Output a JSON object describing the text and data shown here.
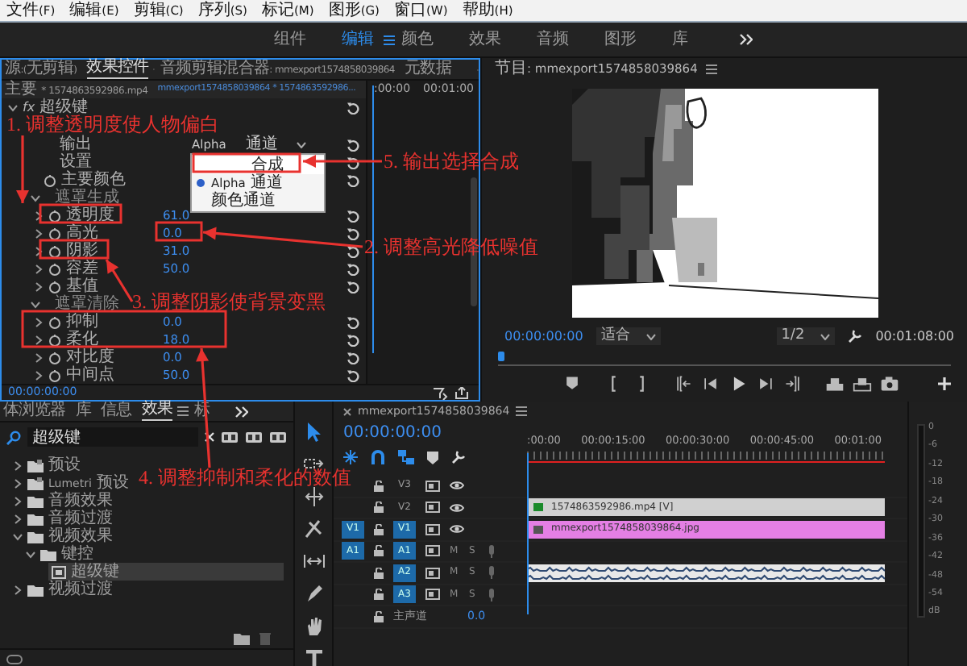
{
  "menu": [
    "文件(F)",
    "编辑(E)",
    "剪辑(C)",
    "序列(S)",
    "标记(M)",
    "图形(G)",
    "窗口(W)",
    "帮助(H)"
  ],
  "workspaces": [
    {
      "label": "组件",
      "selected": false
    },
    {
      "label": "编辑",
      "selected": true
    },
    {
      "label": "颜色",
      "selected": false
    },
    {
      "label": "效果",
      "selected": false
    },
    {
      "label": "音频",
      "selected": false
    },
    {
      "label": "图形",
      "selected": false
    },
    {
      "label": "库",
      "selected": false
    }
  ],
  "effect_controls": {
    "tabs": [
      {
        "label": "源:(无剪辑)",
        "selected": false
      },
      {
        "label": "效果控件",
        "selected": true
      },
      {
        "label": "音频剪辑混合器: mmexport1574858039864",
        "selected": false
      },
      {
        "label": "元数据",
        "selected": false
      }
    ],
    "master_clip": "主要 * 1574863592986.mp4",
    "sequence_clip": "mmexport1574858039864 * 1574863592986...",
    "ruler": [
      ":00:00",
      "00:01:00"
    ],
    "rows": [
      {
        "kind": "effect",
        "badge": "fx",
        "label": "超级键",
        "expanded": true
      },
      {
        "kind": "dropdown",
        "label": "输出",
        "value": "Alpha 通道"
      },
      {
        "kind": "setting",
        "label": "设置"
      },
      {
        "kind": "color",
        "label": "主要颜色"
      },
      {
        "kind": "group",
        "label": "遮罩生成",
        "expanded": true
      },
      {
        "kind": "property",
        "label": "透明度",
        "value": "61.0",
        "expanded": false
      },
      {
        "kind": "property",
        "label": "高光",
        "value": "0.0",
        "expanded": false
      },
      {
        "kind": "property",
        "label": "阴影",
        "value": "31.0",
        "expanded": false
      },
      {
        "kind": "property",
        "label": "容差",
        "value": "50.0",
        "expanded": false
      },
      {
        "kind": "property",
        "label": "基值",
        "expanded": false
      },
      {
        "kind": "group",
        "label": "遮罩清除",
        "expanded": true
      },
      {
        "kind": "property",
        "label": "抑制",
        "value": "0.0",
        "expanded": false
      },
      {
        "kind": "property",
        "label": "柔化",
        "value": "18.0",
        "expanded": false
      },
      {
        "kind": "property",
        "label": "对比度",
        "value": "0.0",
        "expanded": false
      },
      {
        "kind": "property",
        "label": "中间点",
        "value": "50.0",
        "expanded": false
      }
    ],
    "timecode": "00:00:00:00"
  },
  "output_menu": [
    {
      "label": "合成",
      "selected": true,
      "checked": false
    },
    {
      "label": "Alpha 通道",
      "selected": false,
      "checked": true
    },
    {
      "label": "颜色通道",
      "selected": false,
      "checked": false
    }
  ],
  "annotations": [
    "1. 调整透明度使人物偏白",
    "5. 输出选择合成",
    "2. 调整高光降低噪值",
    "3. 调整阴影使背景变黑",
    "4. 调整抑制和柔化的数值"
  ],
  "program": {
    "title": "节目: mmexport1574858039864",
    "timecode": "00:00:00:00",
    "zoom": "适合",
    "resolution": "1/2",
    "duration": "00:01:08:00"
  },
  "effects_panel": {
    "tabs": [
      {
        "label": "体浏览器",
        "selected": false
      },
      {
        "label": "库",
        "selected": false
      },
      {
        "label": "信息",
        "selected": false
      },
      {
        "label": "效果",
        "selected": true
      },
      {
        "label": "标",
        "selected": false
      }
    ],
    "search": {
      "value": "超级键"
    },
    "tree": [
      {
        "label": "预设",
        "kind": "preset",
        "expanded": false,
        "selected": false
      },
      {
        "label": "Lumetri 预设",
        "kind": "preset",
        "expanded": false,
        "selected": false
      },
      {
        "label": "音频效果",
        "kind": "folder",
        "expanded": false,
        "selected": false
      },
      {
        "label": "音频过渡",
        "kind": "folder",
        "expanded": false,
        "selected": false
      },
      {
        "label": "视频效果",
        "kind": "folder",
        "expanded": true,
        "selected": false,
        "children": [
          {
            "label": "键控",
            "kind": "folder",
            "expanded": true,
            "selected": false,
            "children": [
              {
                "label": "超级键",
                "kind": "effect",
                "selected": true
              }
            ]
          }
        ]
      },
      {
        "label": "视频过渡",
        "kind": "folder",
        "expanded": false,
        "selected": false
      }
    ]
  },
  "tools": [
    {
      "kind": "select",
      "selected": true
    },
    {
      "kind": "track-select",
      "selected": false
    },
    {
      "kind": "ripple",
      "selected": false
    },
    {
      "kind": "razor",
      "selected": false
    },
    {
      "kind": "slip",
      "selected": false
    },
    {
      "kind": "pen",
      "selected": false
    },
    {
      "kind": "hand",
      "selected": false
    },
    {
      "kind": "type",
      "selected": false
    }
  ],
  "timeline": {
    "tab": "mmexport1574858039864",
    "timecode": "00:00:00:00",
    "ruler": [
      ":00:00",
      "00:00:15:00",
      "00:00:30:00",
      "00:00:45:00",
      "00:01:00"
    ],
    "tracks": [
      {
        "kind": "video",
        "label": "V3",
        "targeted": false
      },
      {
        "kind": "video",
        "label": "V2",
        "targeted": false,
        "clip": {
          "label": "1574863592986.mp4 [V]",
          "color": "#d0d0d0"
        }
      },
      {
        "kind": "video",
        "label": "V1",
        "targeted": true,
        "source": "V1",
        "clip": {
          "label": "mmexport1574858039864.jpg",
          "color": "#e47fe4"
        }
      },
      {
        "kind": "audio",
        "label": "A1",
        "targeted": true,
        "source": "A1",
        "buttons": [
          "M",
          "S"
        ]
      },
      {
        "kind": "audio",
        "label": "A2",
        "targeted": true,
        "buttons": [
          "M",
          "S"
        ],
        "clip": {
          "kind": "audio"
        }
      },
      {
        "kind": "audio",
        "label": "A3",
        "targeted": true,
        "buttons": [
          "M",
          "S"
        ]
      },
      {
        "kind": "master",
        "label": "主声道",
        "value": "0.0"
      }
    ]
  },
  "meter": [
    "0",
    "-6",
    "-12",
    "-18",
    "-24",
    "-30",
    "-36",
    "-42",
    "-48",
    "-54",
    "dB"
  ]
}
